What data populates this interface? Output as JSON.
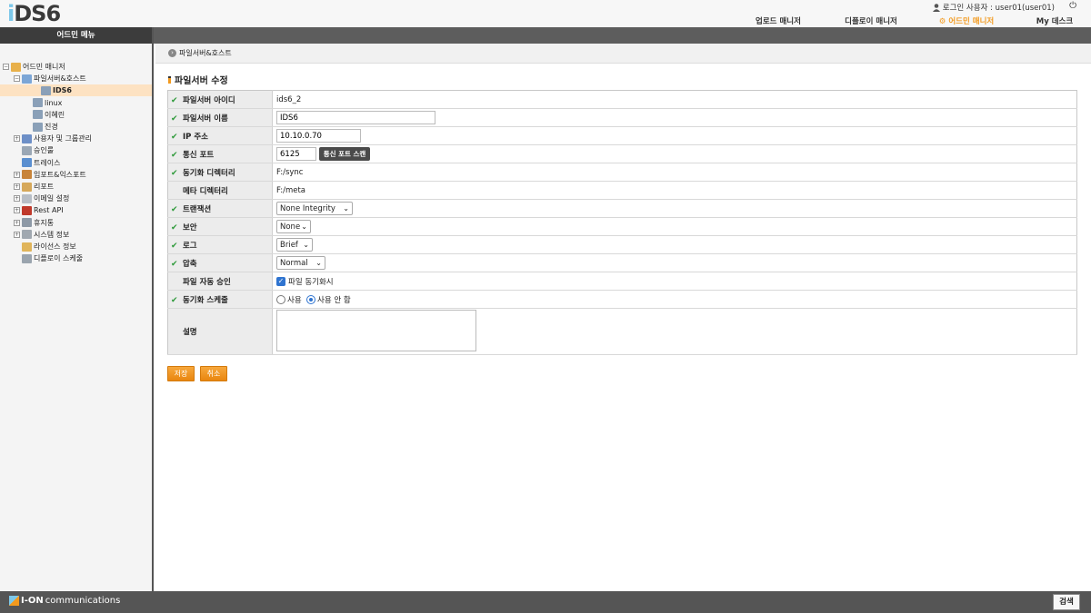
{
  "header": {
    "logo_i": "i",
    "logo_ds": "DS6",
    "login_text": "로그인 사용자 : user01(user01)",
    "nav": [
      {
        "label": "업로드 매니저"
      },
      {
        "label": "디플로이 매니저"
      },
      {
        "label": "어드민 매니저",
        "active": true
      },
      {
        "label": "My 데스크"
      }
    ],
    "active_color": "#f39a1e"
  },
  "sidebar": {
    "title": "어드민 메뉴",
    "tree": [
      {
        "label": "어드민 매니저",
        "level": 0,
        "toggle": "-",
        "icon": "admin-folder-icon"
      },
      {
        "label": "파일서버&호스트",
        "level": 1,
        "toggle": "-",
        "icon": "server-group-icon"
      },
      {
        "label": "IDS6",
        "level": 2,
        "icon": "server-icon",
        "selected": true
      },
      {
        "label": "linux",
        "level": 2,
        "icon": "server-icon"
      },
      {
        "label": "이혜린",
        "level": 2,
        "icon": "server-icon"
      },
      {
        "label": "진경",
        "level": 2,
        "icon": "server-icon"
      },
      {
        "label": "사용자 및 그룹관리",
        "level": 1,
        "toggle": "+",
        "icon": "users-icon"
      },
      {
        "label": "승인룰",
        "level": 1,
        "icon": "approval-icon"
      },
      {
        "label": "트레이스",
        "level": 1,
        "icon": "trace-icon"
      },
      {
        "label": "임포트&익스포트",
        "level": 1,
        "toggle": "+",
        "icon": "import-export-icon"
      },
      {
        "label": "리포트",
        "level": 1,
        "toggle": "+",
        "icon": "report-icon"
      },
      {
        "label": "이메일 설정",
        "level": 1,
        "toggle": "+",
        "icon": "email-icon"
      },
      {
        "label": "Rest API",
        "level": 1,
        "toggle": "+",
        "icon": "api-icon"
      },
      {
        "label": "휴지통",
        "level": 1,
        "toggle": "+",
        "icon": "trash-icon"
      },
      {
        "label": "시스템 정보",
        "level": 1,
        "toggle": "+",
        "icon": "system-info-icon"
      },
      {
        "label": "라이선스 정보",
        "level": 1,
        "icon": "license-icon"
      },
      {
        "label": "디플로이 스케줄",
        "level": 1,
        "icon": "clock-icon"
      }
    ]
  },
  "breadcrumb": {
    "label": "파일서버&호스트"
  },
  "page_title": "파일서버 수정",
  "form": {
    "server_id": {
      "label": "파일서버 아이디",
      "value": "ids6_2"
    },
    "server_name": {
      "label": "파일서버 이름",
      "value": "IDS6"
    },
    "ip": {
      "label": "IP 주소",
      "value": "10.10.0.70"
    },
    "port": {
      "label": "통신 포트",
      "value": "6125",
      "scan_button": "통신 포트 스캔"
    },
    "sync_dir": {
      "label": "동기화 디렉터리",
      "value": "F:/sync"
    },
    "meta_dir": {
      "label": "메타 디렉터리",
      "value": "F:/meta"
    },
    "transaction": {
      "label": "트랜잭션",
      "value": "None Integrity"
    },
    "security": {
      "label": "보안",
      "value": "None"
    },
    "log": {
      "label": "로그",
      "value": "Brief"
    },
    "compression": {
      "label": "압축",
      "value": "Normal"
    },
    "auto_approve": {
      "label": "파일 자동 승인",
      "checkbox_label": "파일 동기화시",
      "checked": true
    },
    "sync_schedule": {
      "label": "동기화 스케줄",
      "option_use": "사용",
      "option_not_use": "사용 안 함",
      "selected": "사용 안 함"
    },
    "description": {
      "label": "설명",
      "value": ""
    }
  },
  "buttons": {
    "save": "저장",
    "cancel": "취소"
  },
  "footer": {
    "logo_bold": "I-ON",
    "logo_text": "communications",
    "search": "검색"
  }
}
